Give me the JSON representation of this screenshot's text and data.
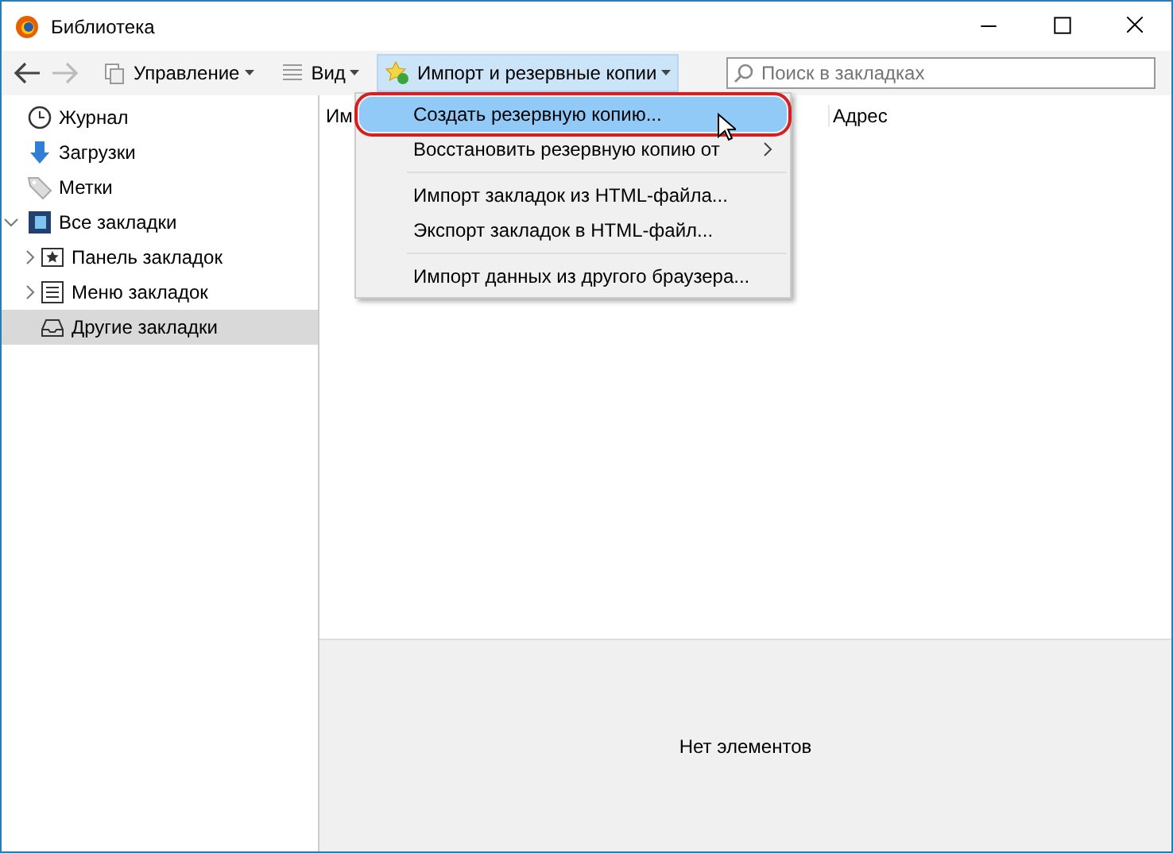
{
  "window": {
    "title": "Библиотека"
  },
  "toolbar": {
    "back": {
      "disabled": false
    },
    "forward": {
      "disabled": true
    },
    "menus": [
      {
        "label": "Управление",
        "open": false
      },
      {
        "label": "Вид",
        "open": false
      },
      {
        "label": "Импорт и резервные копии",
        "open": true
      }
    ],
    "search": {
      "placeholder": "Поиск в закладках"
    }
  },
  "sidebar": {
    "items": [
      {
        "label": "Журнал",
        "selected": false
      },
      {
        "label": "Загрузки",
        "selected": false
      },
      {
        "label": "Метки",
        "selected": false
      },
      {
        "label": "Все закладки",
        "selected": false,
        "expanded": true,
        "children": [
          {
            "label": "Панель закладок",
            "selected": false,
            "expanded": false
          },
          {
            "label": "Меню закладок",
            "selected": false,
            "expanded": false
          },
          {
            "label": "Другие закладки",
            "selected": true
          }
        ]
      }
    ]
  },
  "table": {
    "columns": [
      "Им",
      "Адрес"
    ]
  },
  "details": {
    "text": "Нет элементов"
  },
  "menu": {
    "items": [
      {
        "kind": "item",
        "label": "Создать резервную копию...",
        "selected": true,
        "submenu": false,
        "circled": true
      },
      {
        "kind": "item",
        "label": "Восстановить резервную копию от",
        "selected": false,
        "submenu": true,
        "circled": false
      },
      {
        "kind": "separator"
      },
      {
        "kind": "item",
        "label": "Импорт закладок из HTML-файла...",
        "selected": false,
        "submenu": false,
        "circled": false
      },
      {
        "kind": "item",
        "label": "Экспорт закладок в HTML-файл...",
        "selected": false,
        "submenu": false,
        "circled": false
      },
      {
        "kind": "separator"
      },
      {
        "kind": "item",
        "label": "Импорт данных из другого браузера...",
        "selected": false,
        "submenu": false,
        "circled": false
      }
    ]
  }
}
